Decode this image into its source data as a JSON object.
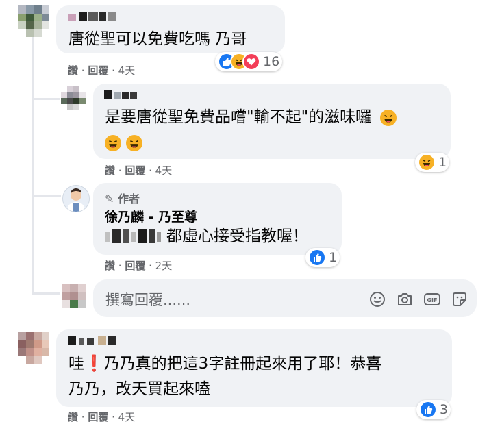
{
  "comments": [
    {
      "text": "唐從聖可以免費吃嗎 乃哥",
      "actions": {
        "like": "讚",
        "reply": "回覆",
        "time": "4天"
      },
      "reaction_count": "16"
    },
    {
      "line1": "是要唐從聖免費品嚐\"輸不起\"的滋味囉",
      "actions": {
        "like": "讚",
        "reply": "回覆",
        "time": "4天"
      },
      "reaction_count": "1"
    },
    {
      "author_badge": "作者",
      "author_name": "徐乃麟",
      "author_suffix": " - 乃至尊",
      "text": "都虛心接受指教喔！",
      "actions": {
        "like": "讚",
        "reply": "回覆",
        "time": "2天"
      },
      "reaction_count": "1"
    },
    {
      "line1": "哇❗乃乃真的把這3字註冊起來用了耶！恭喜",
      "line2": "乃乃，改天買起來嗑",
      "actions": {
        "like": "讚",
        "reply": "回覆",
        "time": "4天"
      },
      "reaction_count": "3"
    }
  ],
  "reply_input": {
    "placeholder": "撰寫回覆......"
  },
  "icons": {
    "input_tools": [
      "emoji-icon",
      "camera-icon",
      "gif-icon",
      "sticker-icon"
    ],
    "reactions": [
      "like-icon",
      "haha-icon",
      "love-icon"
    ]
  },
  "colors": {
    "like": "#1877f2",
    "haha": "#f7b125",
    "love": "#f33e58",
    "bubble": "#f0f2f5",
    "meta": "#65676b"
  }
}
